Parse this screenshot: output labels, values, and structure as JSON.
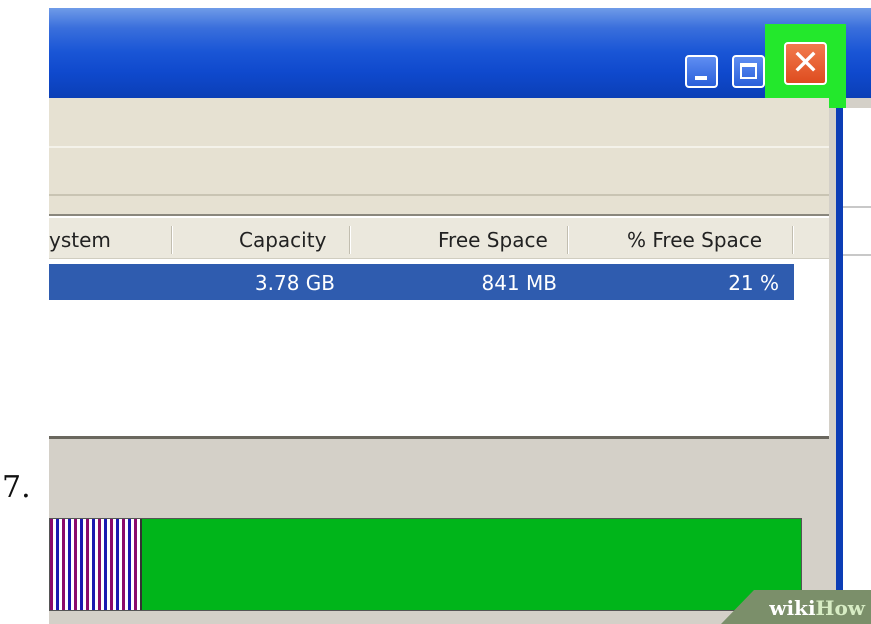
{
  "step": {
    "number": "7."
  },
  "window": {
    "buttons": {
      "minimize_icon": "minimize-icon",
      "maximize_icon": "maximize-icon",
      "close_icon": "close-icon",
      "close_glyph": "✕"
    },
    "highlight_color": "#23e82c"
  },
  "volume_list": {
    "columns": [
      {
        "label": "ystem"
      },
      {
        "label": "Capacity"
      },
      {
        "label": "Free Space"
      },
      {
        "label": "% Free Space"
      }
    ],
    "selected_row": {
      "capacity": "3.78 GB",
      "free_space": "841 MB",
      "percent_free": "21 %"
    }
  },
  "disk_map": {
    "used_fraction": 0.12,
    "free_color": "#00b51a"
  },
  "watermark": {
    "part1": "wiki",
    "part2": "How"
  }
}
